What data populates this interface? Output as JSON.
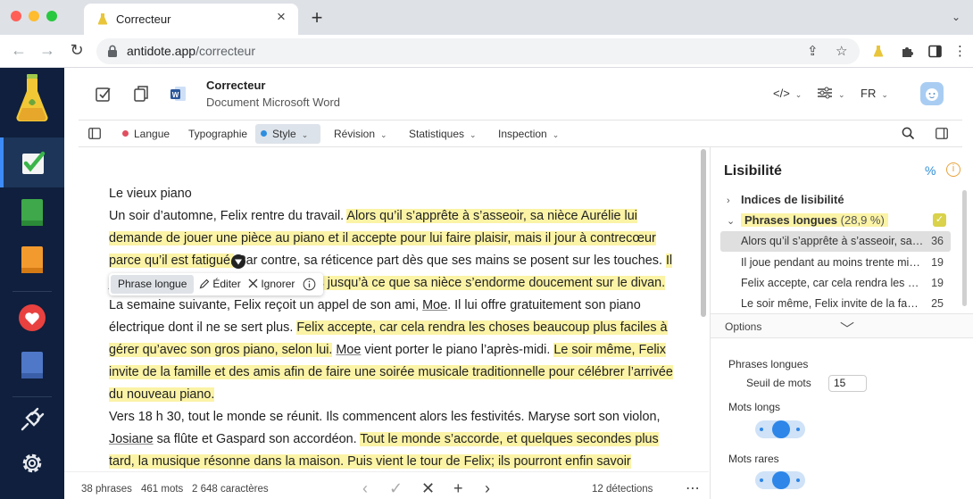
{
  "browser": {
    "tab_title": "Correcteur",
    "url_host": "antidote.app",
    "url_path": "/correcteur"
  },
  "header": {
    "doc_title": "Correcteur",
    "doc_subtitle": "Document Microsoft Word",
    "code_toggle": "</>",
    "language": "FR"
  },
  "toolbar": {
    "items": [
      {
        "label": "Langue",
        "dot": "#e04f5f"
      },
      {
        "label": "Typographie"
      },
      {
        "label": "Style",
        "dot": "#2d8ee0",
        "active": true
      },
      {
        "label": "Révision"
      },
      {
        "label": "Statistiques"
      },
      {
        "label": "Inspection"
      }
    ]
  },
  "document": {
    "title": "Le vieux piano",
    "p1": {
      "a": "Un soir d’automne, Felix rentre du travail. ",
      "hl1": "Alors qu’il s’apprête à s’asseoir, sa nièce Aurélie lui demande de jouer une pièce au piano et il accepte pour lui faire plaisir, mais il jour à contrecœur parce qu’il est fatigué.",
      "b": " Par contre, sa réticence part dès que ses mains se posent sur les touches. ",
      "hl2": "Il joue pendant au moins trente minutes jusqu’à ce que sa nièce s’endorme doucement sur le divan."
    },
    "p2": {
      "a": "La semaine suivante, Felix reçoit un appel de son ami, ",
      "moe1": "Moe",
      "b": ". Il lui offre gratuitement son piano électrique dont il ne se sert plus. ",
      "hl1": "Felix accepte, car cela rendra les choses beaucoup plus faciles à gérer qu’avec son gros piano, selon lui.",
      "c": " ",
      "moe2": "Moe",
      "d": " vient porter le piano l’après-midi. ",
      "hl2": "Le soir même, Felix invite de la famille et des amis afin de faire une soirée musicale traditionnelle pour célébrer l’arrivée du nouveau piano."
    },
    "p3": {
      "a": "Vers 18 h 30, tout le monde se réunit. Ils commencent alors les festivités. Maryse sort son violon, ",
      "josiane": "Josiane",
      "b": " sa flûte et Gaspard son accordéon. ",
      "hl1": "Tout le monde s’accorde, et quelques secondes plus tard, la musique résonne dans la maison. Puis vient le tour de Felix; ils pourront enfin savoir comment"
    }
  },
  "popup": {
    "label": "Phrase longue",
    "edit": "Éditer",
    "ignore": "Ignorer"
  },
  "status": {
    "phrases": "38 phrases",
    "mots": "461 mots",
    "caracteres": "2 648 caractères",
    "detections": "12 détections"
  },
  "panel": {
    "title": "Lisibilité",
    "pct_symbol": "%",
    "row_indices": "Indices de lisibilité",
    "group_label": "Phrases longues",
    "group_pct": "(28,9 %)",
    "items": [
      {
        "text": "Alors qu’il s’apprête à s’asseoir, sa nièce Aurélie",
        "count": "36",
        "selected": true
      },
      {
        "text": "Il joue pendant au moins trente minutes jusqu’à",
        "count": "19"
      },
      {
        "text": "Felix accepte, car cela rendra les choses beaucoup",
        "count": "19"
      },
      {
        "text": "Le soir même, Felix invite de la famille et des amis",
        "count": "25"
      }
    ],
    "options_label": "Options",
    "opt_long_sentences": "Phrases longues",
    "opt_threshold_label": "Seuil de mots",
    "opt_threshold_value": "15",
    "opt_long_words": "Mots longs",
    "opt_rare_words": "Mots rares"
  },
  "colors": {
    "highlight": "#fbf3a6",
    "sidebar_bg": "#0f1f3d",
    "accent": "#2d86e8"
  }
}
